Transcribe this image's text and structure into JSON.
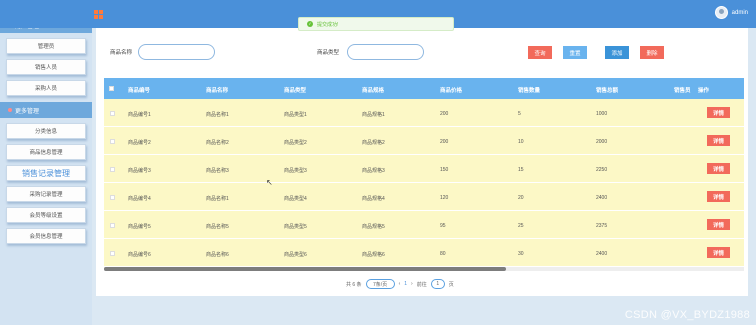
{
  "topbar": {
    "username": "admin"
  },
  "toast": {
    "message": "提交成功!"
  },
  "sidebar": {
    "home": "首页",
    "groups": [
      {
        "label": "用户管理",
        "items": [
          "管理员",
          "销售人员",
          "采购人员"
        ]
      },
      {
        "label": "更多管理",
        "items": [
          "分类信息",
          "商品信息管理",
          "销售记录管理",
          "采购记录管理",
          "会员等级设置",
          "会员信息管理"
        ]
      }
    ]
  },
  "search": {
    "name_label": "商品名称",
    "type_label": "商品类型",
    "query_btn": "查询",
    "reset_btn": "重置",
    "add_btn": "添加",
    "delete_btn": "删除"
  },
  "colors": {
    "query": "#f26a5b",
    "reset": "#69b3ee",
    "add": "#3a93d8",
    "delete": "#f26a5b"
  },
  "table": {
    "headers": [
      "商品编号",
      "商品名称",
      "商品类型",
      "商品规格",
      "商品价格",
      "销售数量",
      "销售总额",
      "销售员",
      "操作"
    ],
    "rows": [
      [
        "商品编号1",
        "商品名称1",
        "商品类型1",
        "商品规格1",
        "200",
        "5",
        "1000",
        "详情"
      ],
      [
        "商品编号2",
        "商品名称2",
        "商品类型2",
        "商品规格2",
        "200",
        "10",
        "2000",
        "详情"
      ],
      [
        "商品编号3",
        "商品名称3",
        "商品类型3",
        "商品规格3",
        "150",
        "15",
        "2250",
        "详情"
      ],
      [
        "商品编号4",
        "商品名称1",
        "商品类型4",
        "商品规格4",
        "120",
        "20",
        "2400",
        "详情"
      ],
      [
        "商品编号5",
        "商品名称5",
        "商品类型5",
        "商品规格5",
        "95",
        "25",
        "2375",
        "详情"
      ],
      [
        "商品编号6",
        "商品名称6",
        "商品类型6",
        "商品规格6",
        "80",
        "30",
        "2400",
        "详情"
      ]
    ]
  },
  "pager": {
    "total": "共 6 条",
    "page_size": "7条/页",
    "prev": "‹",
    "page": "1",
    "next": "›",
    "goto": "前往",
    "goto_value": "1",
    "page_suffix": "页"
  },
  "watermark": "CSDN @VX_BYDZ1988"
}
